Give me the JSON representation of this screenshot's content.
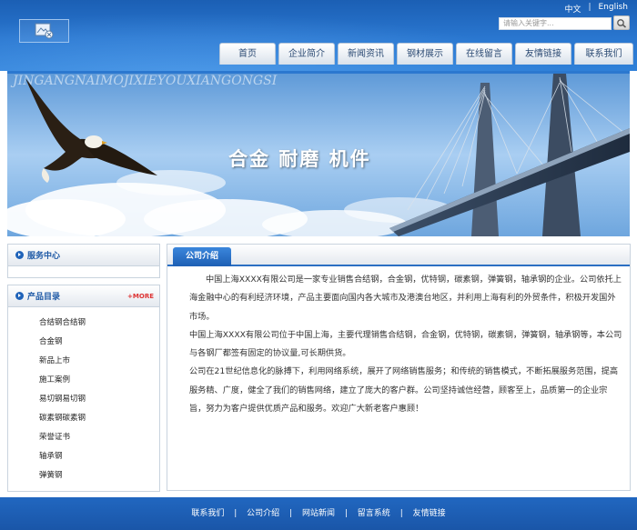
{
  "header": {
    "lang_cn": "中文",
    "lang_sep": "|",
    "lang_en": "English",
    "search_placeholder": "请输入关键字...",
    "logo_icon": "broken-image-icon",
    "search_icon": "magnifier-icon"
  },
  "nav": {
    "items": [
      "首页",
      "企业简介",
      "新闻资讯",
      "钢材展示",
      "在线留言",
      "友情链接",
      "联系我们"
    ]
  },
  "banner": {
    "pinyin": "JINGANGNAIMOJIXIEYOUXIANGONGSI",
    "slogan": "合金 耐磨 机件"
  },
  "sidebar": {
    "service_title": "服务中心",
    "products_title": "产品目录",
    "more": "+MORE",
    "products": [
      "合结钢合结钢",
      "合金钢",
      "新品上市",
      "施工案例",
      "易切钢易切钢",
      "碳素钢碳素钢",
      "荣誉证书",
      "轴承钢",
      "弹簧钢"
    ]
  },
  "main": {
    "tab": "公司介绍",
    "p1": "中国上海XXXX有限公司是一家专业销售合结钢，合金钢，优特钢，碳素钢，弹簧钢，轴承钢的企业。公司依托上海金融中心的有利经济环境，产品主要面向国内各大城市及港澳台地区，并利用上海有利的外贸条件，积极开发国外市场。",
    "p2": "中国上海XXXX有限公司位于中国上海，主要代理销售合结钢，合金钢，优特钢，碳素钢，弹簧钢，轴承钢等，本公司与各钢厂都签有固定的协议量,可长期供货。",
    "p3": "公司在21世纪信息化的脉搏下，利用网络系统，展开了网络销售服务；和传统的销售模式，不断拓展服务范围，提高服务精、广度，健全了我们的销售网络，建立了庞大的客户群。公司坚持诚信经营，顾客至上，品质第一的企业宗旨，努力为客户提供优质产品和服务。欢迎广大新老客户惠顾！"
  },
  "footer": {
    "links": [
      "联系我们",
      "公司介绍",
      "网站新闻",
      "留言系统",
      "友情链接"
    ],
    "sep": "|"
  }
}
